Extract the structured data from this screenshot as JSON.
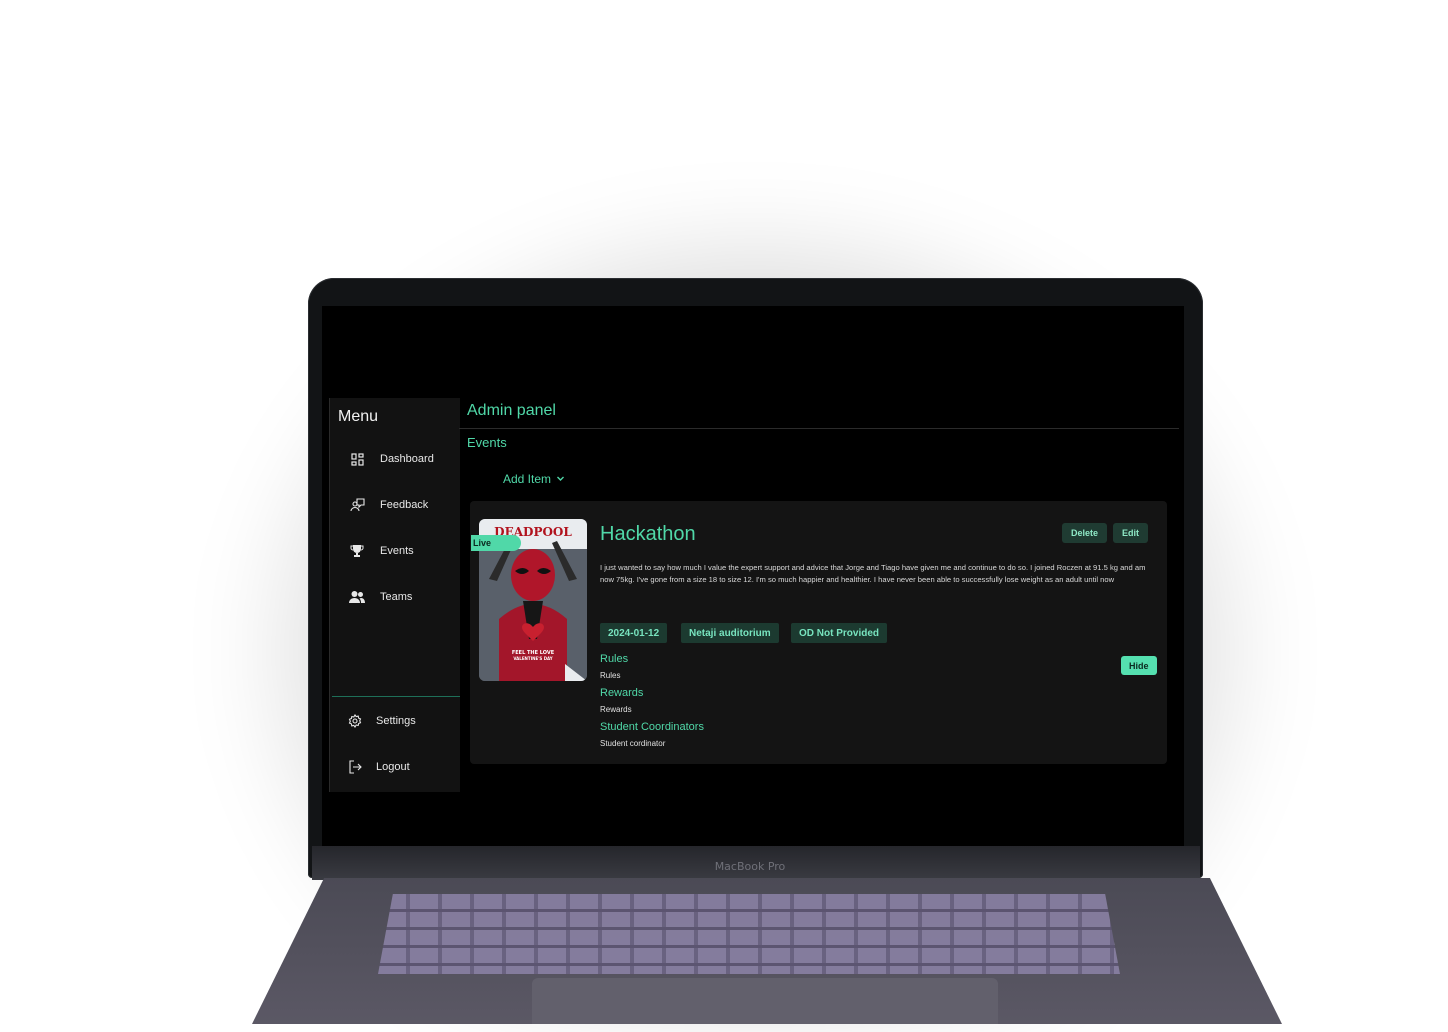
{
  "device": {
    "brand_label": "MacBook Pro"
  },
  "sidebar": {
    "title": "Menu",
    "items": [
      {
        "label": "Dashboard",
        "icon": "dashboard-icon"
      },
      {
        "label": "Feedback",
        "icon": "feedback-icon"
      },
      {
        "label": "Events",
        "icon": "trophy-icon"
      },
      {
        "label": "Teams",
        "icon": "users-icon"
      }
    ],
    "bottom_items": [
      {
        "label": "Settings",
        "icon": "gear-icon"
      },
      {
        "label": "Logout",
        "icon": "logout-icon"
      }
    ]
  },
  "header": {
    "title": "Admin panel",
    "breadcrumb": "Events"
  },
  "toolbar": {
    "add_item_label": "Add Item"
  },
  "event": {
    "status_badge": "Live",
    "poster": {
      "headline": "DEADPOOL",
      "tagline_1": "FEEL THE LOVE",
      "tagline_2": "VALENTINE'S DAY"
    },
    "title": "Hackathon",
    "delete_label": "Delete",
    "edit_label": "Edit",
    "description": "I just wanted to say how much I value the expert support and advice that Jorge and Tiago have given me and continue to do so. I joined Roczen at 91.5 kg and am now 75kg. I've gone from a size 18 to size 12. I'm so much happier and healthier. I have never been able to successfully lose weight as an adult until now",
    "date": "2024-01-12",
    "venue": "Netaji auditorium",
    "od_status": "OD Not Provided",
    "hide_label": "Hide",
    "sections": [
      {
        "heading": "Rules",
        "text": "Rules"
      },
      {
        "heading": "Rewards",
        "text": "Rewards"
      },
      {
        "heading": "Student Coordinators",
        "text": "Student cordinator"
      }
    ]
  },
  "colors": {
    "accent": "#50d8a8",
    "background": "#000000",
    "card": "#141414",
    "sidebar": "#121212"
  }
}
